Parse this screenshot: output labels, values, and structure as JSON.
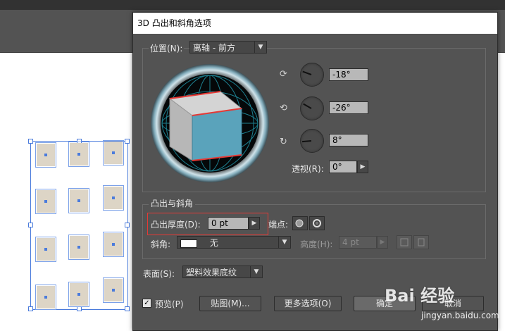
{
  "dialog": {
    "title": "3D 凸出和斜角选项",
    "position_label": "位置(N):",
    "position_value": "离轴 - 前方",
    "rot_x": "-18°",
    "rot_y": "-26°",
    "rot_z": "8°",
    "perspective_label": "透视(R):",
    "perspective_value": "0°",
    "extrude_group_label": "凸出与斜角",
    "depth_label": "凸出厚度(D):",
    "depth_value": "0 pt",
    "cap_label": "端点:",
    "bevel_label": "斜角:",
    "bevel_value": "无",
    "height_label": "高度(H):",
    "height_value": "4 pt",
    "surface_label": "表面(S):",
    "surface_value": "塑料效果底纹",
    "preview_label": "预览(P)",
    "preview_checked": "✓",
    "map_button": "贴图(M)...",
    "more_options_button": "更多选项(O)",
    "ok_button": "确定",
    "cancel_button": "取消"
  },
  "watermark": {
    "brand": "Bai 经验",
    "url": "jingyan.baidu.com"
  },
  "colors": {
    "dialog_bg": "#535353",
    "cube_front": "#5aa3bb",
    "cube_edge": "#e53935",
    "selection": "#4a7bdc"
  }
}
